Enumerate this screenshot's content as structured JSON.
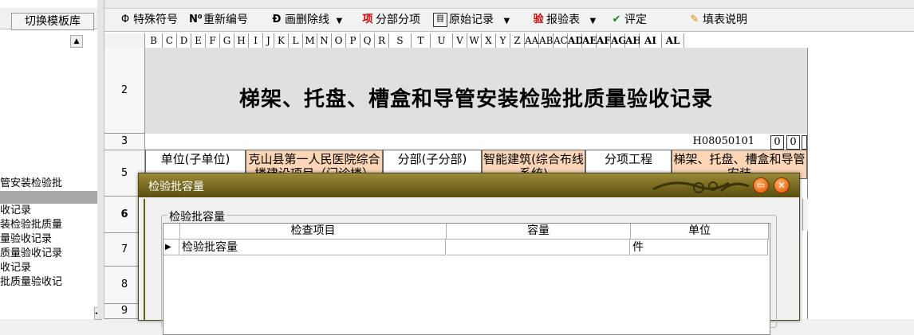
{
  "left_pane": {
    "switch_button": "切换模板库",
    "items": [
      {
        "label": "管安装检验批",
        "selected": false
      },
      {
        "label": "",
        "selected": true
      },
      {
        "label": "收记录",
        "selected": false
      },
      {
        "label": "装检验批质量",
        "selected": false
      },
      {
        "label": "量验收记录",
        "selected": false
      },
      {
        "label": "质量验收记录",
        "selected": false
      },
      {
        "label": "收记录",
        "selected": false
      },
      {
        "label": "批质量验收记",
        "selected": false
      }
    ]
  },
  "toolbar": {
    "special_char": "特殊符号",
    "renumber": "重新编号",
    "draw_delete_line": "画删除线",
    "sub_items": "分部分项",
    "original_record": "原始记录",
    "report_test": "报验表",
    "evaluate": "评定",
    "fill_instructions": "填表说明"
  },
  "sheet": {
    "columns": [
      "B",
      "C",
      "D",
      "E",
      "F",
      "G",
      "H",
      "I",
      "J",
      "K",
      "L",
      "M",
      "N",
      "O",
      "P",
      "Q",
      "R",
      "S",
      "T",
      "U",
      "V",
      "W",
      "X",
      "Y",
      "Z",
      "AA",
      "AB",
      "AC",
      "AD",
      "AE",
      "AF",
      "AG",
      "AH",
      "AI",
      "AL"
    ],
    "rows": [
      "2",
      "3",
      "5",
      "6",
      "7",
      "8",
      "9"
    ],
    "title": "梯架、托盘、槽盒和导管安装检验批质量验收记录",
    "code": "H08050101",
    "code_boxes": [
      "0",
      "0",
      "1"
    ],
    "row5_cells": [
      "单位(子单位)",
      "克山县第一人民医院综合楼建设项目（门诊楼）",
      "分部(子分部)",
      "智能建筑(综合布线系统)",
      "分项工程",
      "梯架、托盘、槽盒和导管安装"
    ]
  },
  "dialog": {
    "title": "检验批容量",
    "group_label": "检验批容量",
    "grid": {
      "headers": [
        "检查项目",
        "容量",
        "单位"
      ],
      "rows": [
        {
          "item": "检验批容量",
          "capacity": "",
          "unit": "件"
        }
      ]
    },
    "min_glyph": "▭",
    "close_glyph": "✕"
  },
  "colors": {
    "dialog_title_bar": "#7a6b20",
    "header_peach": "#fbd5b5",
    "title_band": "#e0e0e0",
    "window_button": "#e05000"
  }
}
